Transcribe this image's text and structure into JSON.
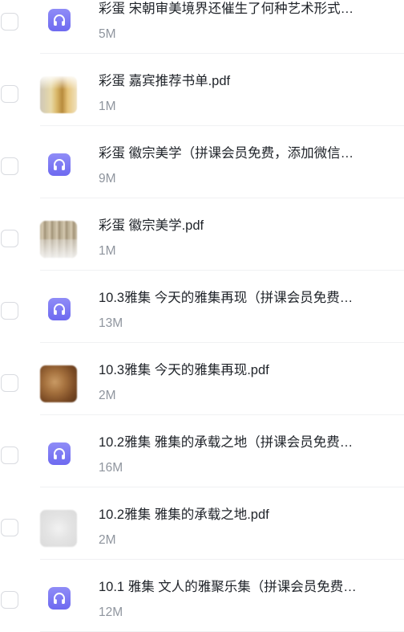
{
  "files": [
    {
      "name": "彩蛋 宋朝审美境界还催生了何种艺术形式…",
      "size": "5M",
      "thumb": "audio",
      "icon": "headphones-icon"
    },
    {
      "name": "彩蛋 嘉宾推荐书单.pdf",
      "size": "1M",
      "thumb": "img1",
      "icon": "pdf-thumbnail"
    },
    {
      "name": "彩蛋 徽宗美学（拼课会员免费，添加微信…",
      "size": "9M",
      "thumb": "audio",
      "icon": "headphones-icon"
    },
    {
      "name": "彩蛋 徽宗美学.pdf",
      "size": "1M",
      "thumb": "img2",
      "icon": "pdf-thumbnail"
    },
    {
      "name": "10.3雅集 今天的雅集再现（拼课会员免费…",
      "size": "13M",
      "thumb": "audio",
      "icon": "headphones-icon"
    },
    {
      "name": "10.3雅集 今天的雅集再现.pdf",
      "size": "2M",
      "thumb": "img3",
      "icon": "pdf-thumbnail"
    },
    {
      "name": "10.2雅集 雅集的承载之地（拼课会员免费…",
      "size": "16M",
      "thumb": "audio",
      "icon": "headphones-icon"
    },
    {
      "name": "10.2雅集 雅集的承载之地.pdf",
      "size": "2M",
      "thumb": "img4",
      "icon": "pdf-thumbnail"
    },
    {
      "name": "10.1 雅集 文人的雅聚乐集（拼课会员免费…",
      "size": "12M",
      "thumb": "audio",
      "icon": "headphones-icon"
    }
  ],
  "colors": {
    "audio_icon_bg": "#7a77f3",
    "title_text": "#1f2329",
    "size_text": "#8f959e",
    "checkbox_border": "#d9dbe0"
  }
}
